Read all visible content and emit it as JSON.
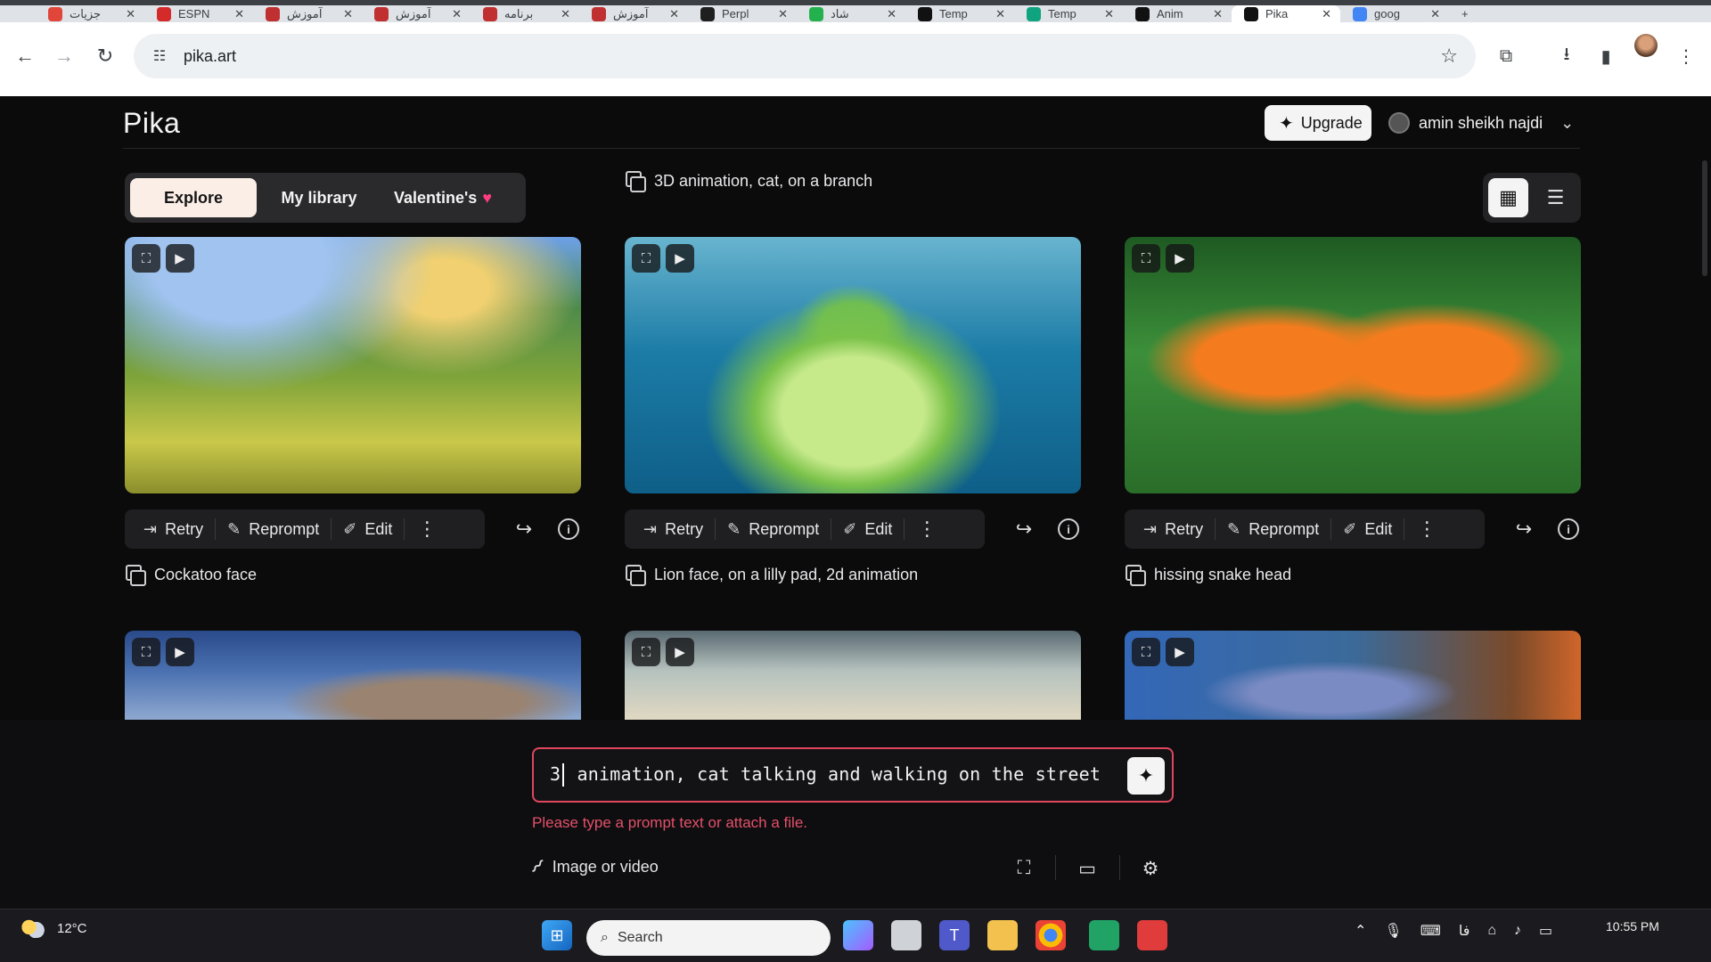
{
  "browser": {
    "tabs": [
      {
        "label": "جزیات",
        "color": "#e0463a"
      },
      {
        "label": "ESPN",
        "color": "#d42a2a"
      },
      {
        "label": "آموزش",
        "color": "#c03030"
      },
      {
        "label": "آموزش",
        "color": "#c03030"
      },
      {
        "label": "برنامه",
        "color": "#c03030"
      },
      {
        "label": "آموزش",
        "color": "#c03030"
      },
      {
        "label": "Perpl",
        "color": "#1f1f1f"
      },
      {
        "label": "شاد",
        "color": "#22b14c"
      },
      {
        "label": "Temp",
        "color": "#111111"
      },
      {
        "label": "Temp",
        "color": "#10a37f"
      },
      {
        "label": "Anim",
        "color": "#111111"
      },
      {
        "label": "Pika",
        "color": "#111111"
      },
      {
        "label": "goog",
        "color": "#4285f4"
      }
    ],
    "active_tab_index": 11,
    "new_tab": "+",
    "url": "pika.art"
  },
  "app": {
    "logo": "Pika",
    "upgrade_label": "Upgrade",
    "user_name": "amin sheikh najdi",
    "nav_tabs": [
      {
        "label": "Explore"
      },
      {
        "label": "My library"
      },
      {
        "label": "Valentine's"
      }
    ],
    "active_nav": "Explore",
    "top_caption": "3D animation, cat, on a branch",
    "actions": {
      "retry": "Retry",
      "reprompt": "Reprompt",
      "edit": "Edit"
    },
    "cards_row1": [
      {
        "caption": "Cockatoo face"
      },
      {
        "caption": "Lion face, on a lilly pad, 2d animation"
      },
      {
        "caption": "hissing snake head"
      }
    ],
    "prompt": {
      "text_before_cursor": "3",
      "text_after_cursor": " animation, cat talking and walking on the street",
      "error": "Please type a prompt text or attach a file.",
      "attach_label": "Image or video"
    }
  },
  "taskbar": {
    "temperature": "12°C",
    "search_placeholder": "Search",
    "time": "10:55 PM",
    "lang": "فا"
  }
}
